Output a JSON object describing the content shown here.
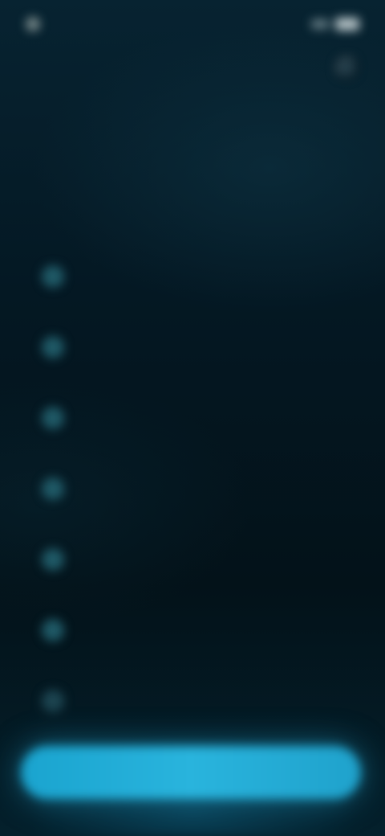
{
  "status_bar": {
    "time": ""
  },
  "screen": {
    "title": "",
    "subtitle": "",
    "options": [
      {
        "label": ""
      },
      {
        "label": ""
      },
      {
        "label": ""
      },
      {
        "label": ""
      },
      {
        "label": ""
      },
      {
        "label": ""
      },
      {
        "label": ""
      }
    ],
    "continue_label": ""
  },
  "icons": {
    "close": "close-icon",
    "radio": "radio-circle-icon",
    "battery": "battery-icon",
    "signal": "signal-icon"
  },
  "colors": {
    "background": "#04161f",
    "accent": "#22aad6",
    "radio": "#1f5966"
  }
}
